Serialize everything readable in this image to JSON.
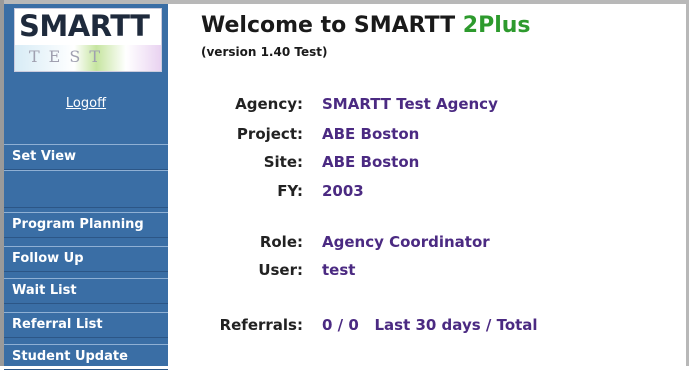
{
  "logo": {
    "word": "SMARTT",
    "sub": "TEST"
  },
  "sidebar": {
    "logoff": "Logoff",
    "items": [
      {
        "label": "Set View"
      },
      {
        "label": ""
      },
      {
        "label": "Program Planning"
      },
      {
        "label": "Follow Up"
      },
      {
        "label": "Wait List"
      },
      {
        "label": "Referral List"
      },
      {
        "label": "Student Update"
      }
    ]
  },
  "header": {
    "title_prefix": "Welcome to SMARTT ",
    "title_accent": "2Plus",
    "version": "(version 1.40 Test)"
  },
  "info": {
    "agency_label": "Agency:",
    "agency_value": "SMARTT Test Agency",
    "project_label": "Project:",
    "project_value": "ABE Boston",
    "site_label": "Site:",
    "site_value": "ABE Boston",
    "fy_label": "FY:",
    "fy_value": "2003",
    "role_label": "Role:",
    "role_value": "Agency Coordinator",
    "user_label": "User:",
    "user_value": "test",
    "referrals_label": "Referrals:",
    "referrals_value": "0 / 0   Last 30 days / Total"
  },
  "colors": {
    "sidebar_bg": "#3a6ea5",
    "value_text": "#4b2a82",
    "accent_green": "#2d9a2d"
  }
}
